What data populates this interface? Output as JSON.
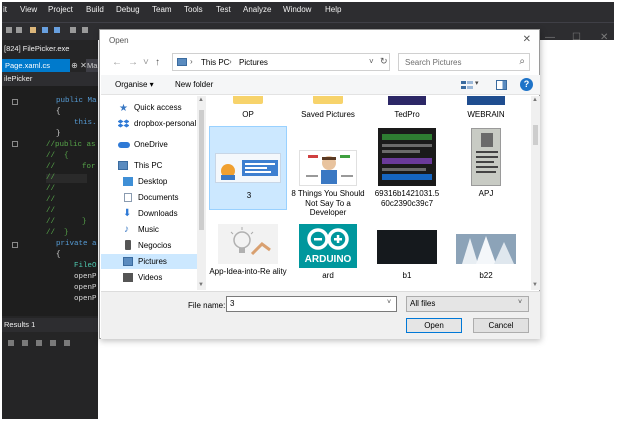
{
  "vs": {
    "menu": [
      "it",
      "View",
      "Project",
      "Build",
      "Debug",
      "Team",
      "Tools",
      "Test",
      "Analyze",
      "Window",
      "Help"
    ],
    "exe_label": "[824] FilePicker.exe",
    "tab_label": "Page.xaml.cs",
    "tab_pin": "⊕ ✕",
    "tab2_label": "Ma",
    "project_label": "ilePicker",
    "code": {
      "l1": "public Ma",
      "l2": "{",
      "l3": "this.",
      "l4": "}",
      "l5": "//public as",
      "l6": "//  {",
      "l7": "//      for",
      "l8": "//",
      "l9": "//",
      "l10": "//",
      "l11": "//",
      "l12": "//      }",
      "l13": "//  }",
      "l14": "private a",
      "l15": "{",
      "l16": "FileO",
      "l17": "openP",
      "l18": "openP",
      "l19": "openP"
    },
    "results_label": "Results 1",
    "window_controls": [
      "—",
      "☐",
      "✕"
    ]
  },
  "dialog": {
    "title": "Open",
    "close": "✕",
    "nav": {
      "back": "←",
      "forward": "→",
      "recent": "˅",
      "up": "↑"
    },
    "address": {
      "sep": "›",
      "segments": [
        "This PC",
        "Pictures"
      ],
      "dropdown": "˅",
      "refresh": "↻"
    },
    "search": {
      "placeholder": "Search Pictures",
      "icon": "⌕"
    },
    "toolbar": {
      "organise": "Organise ▾",
      "new_folder": "New folder",
      "view_dropdown": "▾",
      "help": "?"
    },
    "nav_pane": [
      {
        "label": "Quick access",
        "icon": "star-icon",
        "color": "#3a78c3"
      },
      {
        "label": "dropbox-personal",
        "icon": "dropbox-icon",
        "color": "#2f7ad6"
      },
      {
        "label": "OneDrive",
        "icon": "cloud-icon",
        "color": "#2f7ad6"
      },
      {
        "label": "This PC",
        "icon": "computer-icon",
        "color": "#5a8bbf"
      },
      {
        "label": "Desktop",
        "icon": "desktop-icon",
        "color": "#3f8fd6"
      },
      {
        "label": "Documents",
        "icon": "documents-icon",
        "color": "#8a9bb0"
      },
      {
        "label": "Downloads",
        "icon": "download-icon",
        "color": "#2f7ad6"
      },
      {
        "label": "Music",
        "icon": "music-icon",
        "color": "#3a78c3"
      },
      {
        "label": "Negocios",
        "icon": "phone-icon",
        "color": "#555555"
      },
      {
        "label": "Pictures",
        "icon": "pictures-icon",
        "color": "#5a8bbf"
      },
      {
        "label": "Videos",
        "icon": "videos-icon",
        "color": "#555555"
      }
    ],
    "files": [
      {
        "label": "OP"
      },
      {
        "label": "Saved Pictures"
      },
      {
        "label": "TedPro"
      },
      {
        "label": "WEBRAIN"
      },
      {
        "label": "3"
      },
      {
        "label": "8 Things You Should Not Say To a Developer"
      },
      {
        "label": "69316b1421031.5 60c2390c39c7"
      },
      {
        "label": "APJ"
      },
      {
        "label": "App-Idea-into-Re ality"
      },
      {
        "label": "ard",
        "thumb_text": "ARDUINO"
      },
      {
        "label": "b1"
      },
      {
        "label": "b22"
      }
    ],
    "bottom": {
      "file_name_label": "File name:",
      "file_name_value": "3",
      "filter": "All files",
      "dropdown": "˅",
      "open": "Open",
      "cancel": "Cancel"
    }
  },
  "colors": {
    "vs_dark": "#2d2d30",
    "vs_editor": "#1e1e1e",
    "vs_accent": "#007acc",
    "selection": "#cce8ff",
    "selection_border": "#99d1ff",
    "folder": "#f7d36b"
  }
}
